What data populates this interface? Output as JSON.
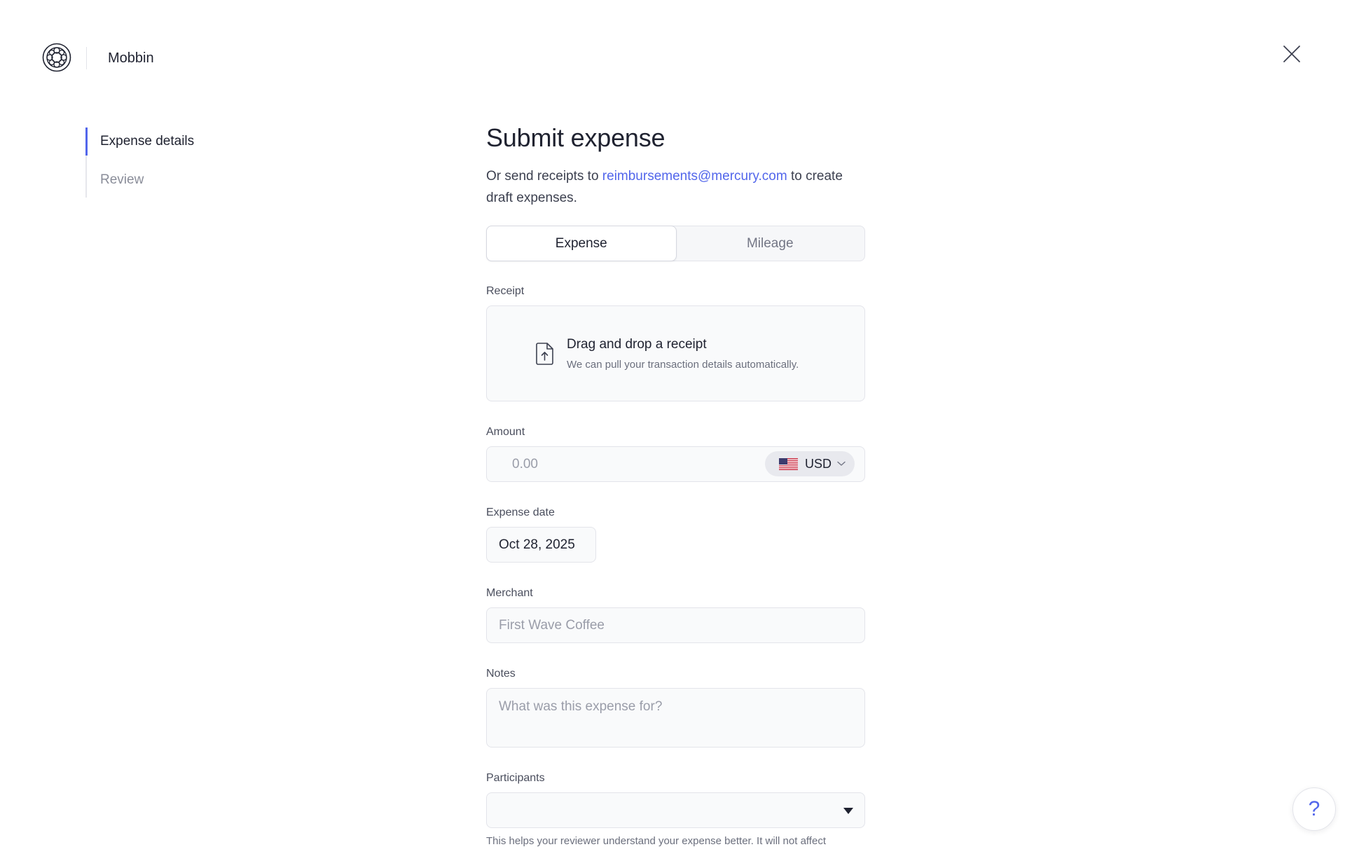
{
  "header": {
    "org_name": "Mobbin",
    "logo_icon": "mercury-logo-icon",
    "close_icon": "close-icon"
  },
  "steps": [
    {
      "label": "Expense details",
      "active": true
    },
    {
      "label": "Review",
      "active": false
    }
  ],
  "form": {
    "title": "Submit expense",
    "subtitle_pre": "Or send receipts to ",
    "subtitle_email": "reimbursements@mercury.com",
    "subtitle_post": " to create draft expenses.",
    "tabs": [
      {
        "label": "Expense",
        "active": true
      },
      {
        "label": "Mileage",
        "active": false
      }
    ],
    "receipt": {
      "label": "Receipt",
      "title": "Drag and drop a receipt",
      "subtitle": "We can pull your transaction details automatically.",
      "icon": "file-upload-icon"
    },
    "amount": {
      "label": "Amount",
      "symbol": "$",
      "placeholder": "0.00",
      "currency": "USD",
      "flag_icon": "us-flag-icon"
    },
    "date": {
      "label": "Expense date",
      "value": "Oct 28, 2025"
    },
    "merchant": {
      "label": "Merchant",
      "placeholder": "First Wave Coffee"
    },
    "notes": {
      "label": "Notes",
      "placeholder": "What was this expense for?"
    },
    "participants": {
      "label": "Participants",
      "hint": "This helps your reviewer understand your expense better. It will not affect"
    }
  },
  "help": {
    "label": "?"
  },
  "colors": {
    "accent": "#5266eb",
    "text": "#1f2230",
    "muted": "#8a8d99",
    "border": "#e3e4ea",
    "field_bg": "#f9fafb"
  }
}
